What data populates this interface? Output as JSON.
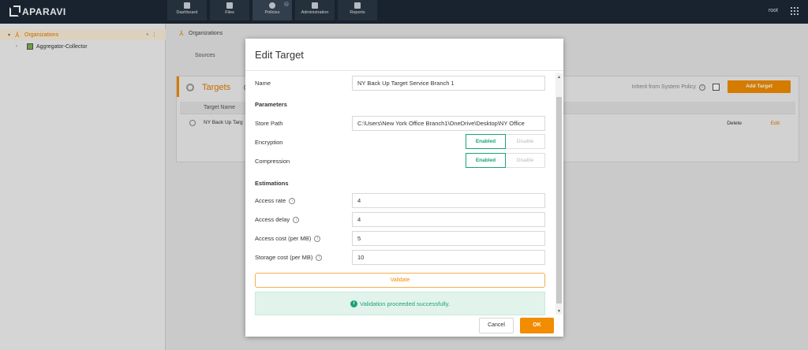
{
  "header": {
    "logo": "APARAVI",
    "tabs": [
      {
        "label": "Dashboard",
        "icon": "dashboard-icon"
      },
      {
        "label": "Files",
        "icon": "folder-icon"
      },
      {
        "label": "Policies",
        "icon": "gear-icon"
      },
      {
        "label": "Administration",
        "icon": "users-icon"
      },
      {
        "label": "Reports",
        "icon": "report-icon"
      }
    ],
    "user": "root"
  },
  "sidebar": {
    "items": [
      {
        "label": "Organizations"
      },
      {
        "label": "Aggregator-Collector"
      }
    ]
  },
  "main": {
    "breadcrumb": "Organizations",
    "subtab": "Sources",
    "targets_title": "Targets",
    "inherit_label": "Inherit from System Policy",
    "add_target": "Add Target",
    "table": {
      "header_name": "Target Name",
      "row_name": "NY Back Up Targ",
      "delete": "Delete",
      "edit": "Edit"
    }
  },
  "modal": {
    "title": "Edit Target",
    "name_label": "Name",
    "name_value": "NY Back Up Target Service Branch 1",
    "parameters_title": "Parameters",
    "store_path_label": "Store Path",
    "store_path_value": "C:\\Users\\New York Office Branch1\\OneDrive\\Desktop\\NY Office",
    "encryption_label": "Encryption",
    "compression_label": "Compression",
    "enabled": "Enabled",
    "disable": "Disable",
    "estimations_title": "Estimations",
    "access_rate_label": "Access rate",
    "access_rate_value": "4",
    "access_delay_label": "Access delay",
    "access_delay_value": "4",
    "access_cost_label": "Access cost (per MB)",
    "access_cost_value": "5",
    "storage_cost_label": "Storage cost (per MB)",
    "storage_cost_value": "10",
    "validate": "Validate",
    "success_message": "Validation proceeded successfully.",
    "cancel": "Cancel",
    "ok": "OK"
  },
  "colors": {
    "accent": "#f28c00",
    "success": "#1aa37a",
    "header_bg": "#1d2836"
  }
}
